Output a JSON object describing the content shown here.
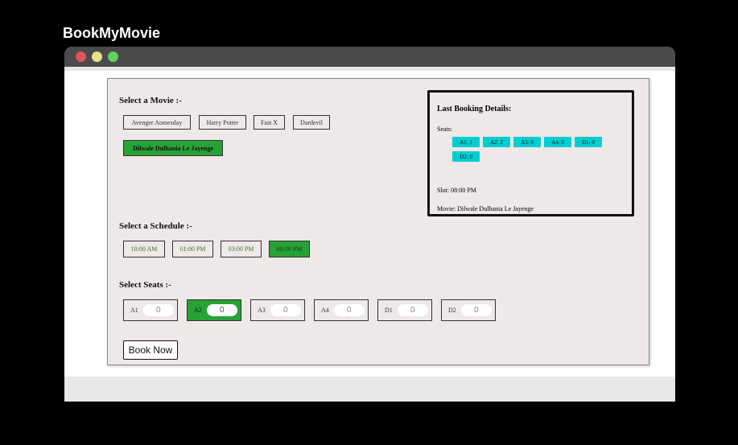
{
  "app": {
    "title": "BookMyMovie"
  },
  "movies": {
    "heading": "Select a Movie :-",
    "items": [
      "Avenger Aomesday",
      "Harry Potter",
      "Fast X",
      "Dardevil",
      "Dilwale Dulhania Le Jayenge"
    ],
    "selected": "Dilwale Dulhania Le Jayenge"
  },
  "schedule": {
    "heading": "Select a Schedule :-",
    "items": [
      "10:00 AM",
      "01:00 PM",
      "03:00 PM",
      "08:00 PM"
    ],
    "selected": "08:00 PM"
  },
  "seats": {
    "heading": "Select Seats :-",
    "items": [
      {
        "label": "A1",
        "value": "0"
      },
      {
        "label": "A2",
        "value": "0"
      },
      {
        "label": "A3",
        "value": "0"
      },
      {
        "label": "A4",
        "value": "0"
      },
      {
        "label": "D1",
        "value": "0"
      },
      {
        "label": "D2",
        "value": "0"
      }
    ],
    "selected": "A2"
  },
  "book_button": "Book Now",
  "last_booking": {
    "title": "Last Booking Details:",
    "seats_label": "Seats:",
    "seat_tags": [
      "A1: 1",
      "A2: 2",
      "A3: 0",
      "A4: 0",
      "D1: 0",
      "D2: 0"
    ],
    "slot": "Slot: 08:00 PM",
    "movie": "Movie: Dilwale Dulhania Le Jayenge"
  },
  "colors": {
    "selected": "#28a237",
    "tag": "#00ced1",
    "panel": "#efe8e8"
  }
}
